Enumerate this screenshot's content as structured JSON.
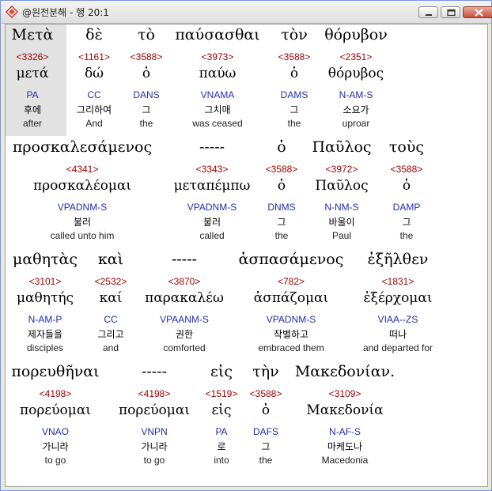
{
  "window": {
    "title": "@원전분해 - 행 20:1",
    "buttons": {
      "minimize": "minimize-icon",
      "maximize": "maximize-icon",
      "close": "close-icon"
    }
  },
  "words": [
    {
      "g": "Μετὰ",
      "s": "<3326>",
      "l": "μετά",
      "p": "PA",
      "k": "후에",
      "e": "after"
    },
    {
      "g": "δὲ",
      "s": "<1161>",
      "l": "δώ",
      "p": "CC",
      "k": "그리하여",
      "e": "And"
    },
    {
      "g": "τὸ",
      "s": "<3588>",
      "l": "ὁ",
      "p": "DANS",
      "k": "그",
      "e": "the"
    },
    {
      "g": "παύσασθαι",
      "s": "<3973>",
      "l": "παύω",
      "p": "VNAMA",
      "k": "그치매",
      "e": "was ceased"
    },
    {
      "g": "τὸν",
      "s": "<3588>",
      "l": "ὁ",
      "p": "DAMS",
      "k": "그",
      "e": "the"
    },
    {
      "g": "θόρυβον",
      "s": "<2351>",
      "l": "θόρυβος",
      "p": "N-AM-S",
      "k": "소요가",
      "e": "uproar"
    },
    {
      "g": "προσκαλεσάμενος",
      "s": "<4341>",
      "l": "προσκαλέομαι",
      "p": "VPADNM-S",
      "k": "불러",
      "e": "called unto him"
    },
    {
      "g": "-----",
      "s": "<3343>",
      "l": "μεταπέμπω",
      "p": "VPADNM-S",
      "k": "불러",
      "e": "called"
    },
    {
      "g": "ὁ",
      "s": "<3588>",
      "l": "ὁ",
      "p": "DNMS",
      "k": "그",
      "e": "the"
    },
    {
      "g": "Παῦλος",
      "s": "<3972>",
      "l": "Παῦλος",
      "p": "N-NM-S",
      "k": "바울이",
      "e": "Paul"
    },
    {
      "g": "τοὺς",
      "s": "<3588>",
      "l": "ὁ",
      "p": "DAMP",
      "k": "그",
      "e": "the"
    },
    {
      "g": "μαθητὰς",
      "s": "<3101>",
      "l": "μαθητής",
      "p": "N-AM-P",
      "k": "제자들을",
      "e": "disciples"
    },
    {
      "g": "καὶ",
      "s": "<2532>",
      "l": "καί",
      "p": "CC",
      "k": "그리고",
      "e": "and"
    },
    {
      "g": "-----",
      "s": "<3870>",
      "l": "παρακαλέω",
      "p": "VPAANM-S",
      "k": "권한",
      "e": "comforted"
    },
    {
      "g": "ἀσπασάμενος",
      "s": "<782>",
      "l": "ἀσπάζομαι",
      "p": "VPADNM-S",
      "k": "작별하고",
      "e": "embraced them"
    },
    {
      "g": "ἐξῆλθεν",
      "s": "<1831>",
      "l": "ἐξέρχομαι",
      "p": "VIAA--ZS",
      "k": "떠나",
      "e": "and departed for"
    },
    {
      "g": "πορευθῆναι",
      "s": "<4198>",
      "l": "πορεύομαι",
      "p": "VNAO",
      "k": "가니라",
      "e": "to go"
    },
    {
      "g": "-----",
      "s": "<4198>",
      "l": "πορεύομαι",
      "p": "VNPN",
      "k": "가니라",
      "e": "to go"
    },
    {
      "g": "εἰς",
      "s": "<1519>",
      "l": "εἰς",
      "p": "PA",
      "k": "로",
      "e": "into"
    },
    {
      "g": "τὴν",
      "s": "<3588>",
      "l": "ὁ",
      "p": "DAFS",
      "k": "그",
      "e": "the"
    },
    {
      "g": "Μακεδονίαν.",
      "s": "<3109>",
      "l": "Μακεδονία",
      "p": "N-AF-S",
      "k": "마케도나",
      "e": "Macedonia"
    }
  ]
}
